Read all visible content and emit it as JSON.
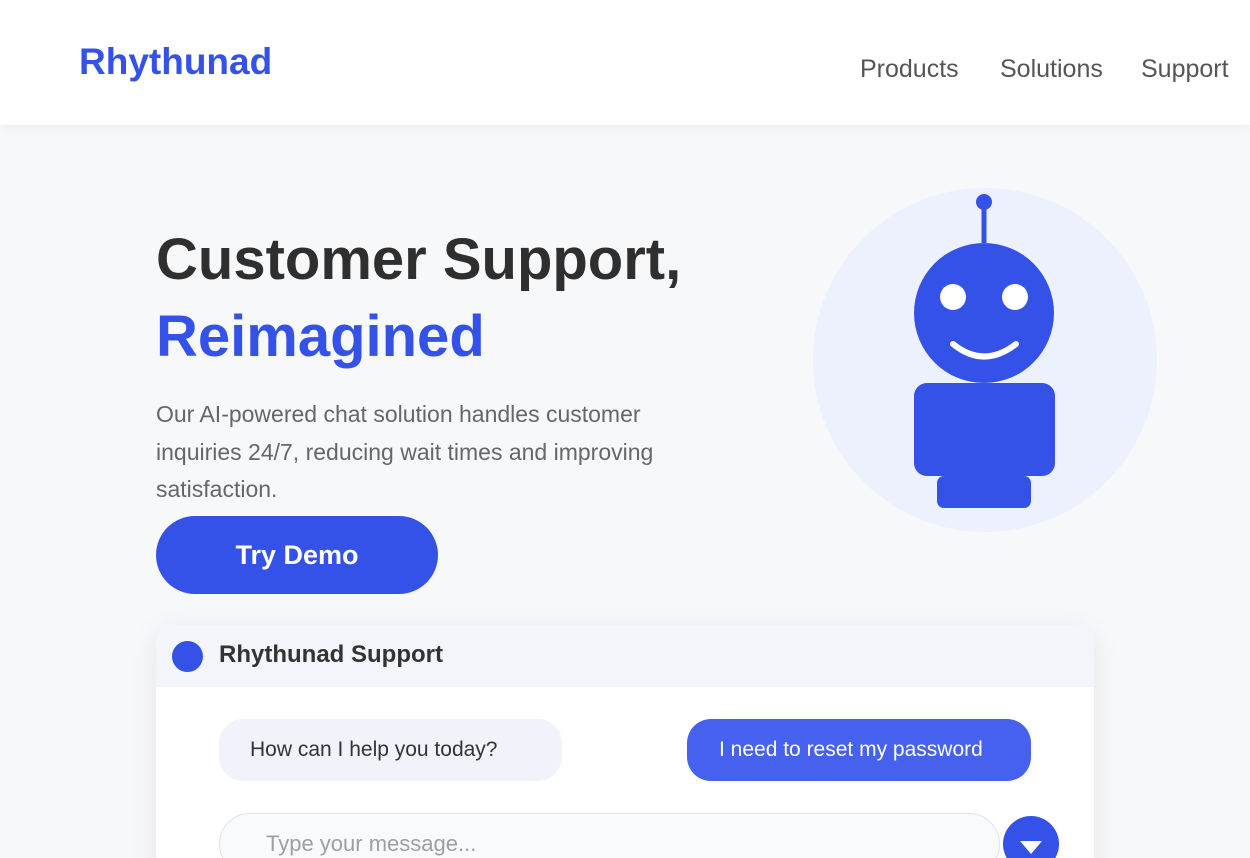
{
  "brand": {
    "name": "Rhythunad",
    "accent_color": "#3452e8"
  },
  "nav": {
    "items": [
      "Products",
      "Solutions",
      "Support"
    ]
  },
  "hero": {
    "title": "Customer Support,",
    "title_accent": "Reimagined",
    "description": "Our AI-powered chat solution handles customer inquiries 24/7, reducing wait times and improving satisfaction.",
    "cta_label": "Try Demo",
    "illustration_icon": "robot-icon"
  },
  "chat": {
    "title": "Rhythunad Support",
    "messages": [
      {
        "sender": "bot",
        "text": "How can I help you today?"
      },
      {
        "sender": "user",
        "text": "I need to reset my password"
      }
    ],
    "input_placeholder": "Type your message...",
    "send_icon": "chevron-down-icon"
  }
}
